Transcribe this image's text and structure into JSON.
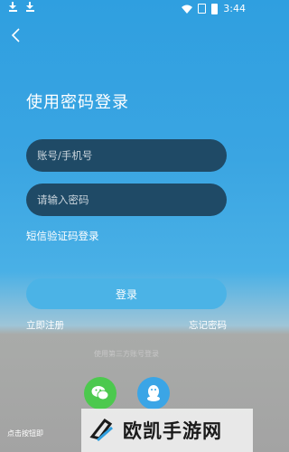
{
  "status_bar": {
    "time": "3:44"
  },
  "title": "使用密码登录",
  "account_field": {
    "placeholder": "账号/手机号"
  },
  "password_field": {
    "placeholder": "请输入密码"
  },
  "sms_login_link": "短信验证码登录",
  "login_button": "登录",
  "register_link": "立即注册",
  "forgot_link": "忘记密码",
  "third_party_label": "使用第三方账号登录",
  "agreement_text": "点击按钮即",
  "watermark_text": "欧凯手游网",
  "colors": {
    "accent": "#3aa5e2",
    "field_bg": "#1f4a66",
    "button_bg": "#4bb3e6",
    "wechat": "#4cc94e",
    "qq": "#3ba5e6"
  },
  "icons": [
    "download-icon",
    "download-icon",
    "wifi-icon",
    "no-sim-icon",
    "battery-icon",
    "back-arrow-icon",
    "wechat-icon",
    "qq-icon"
  ]
}
